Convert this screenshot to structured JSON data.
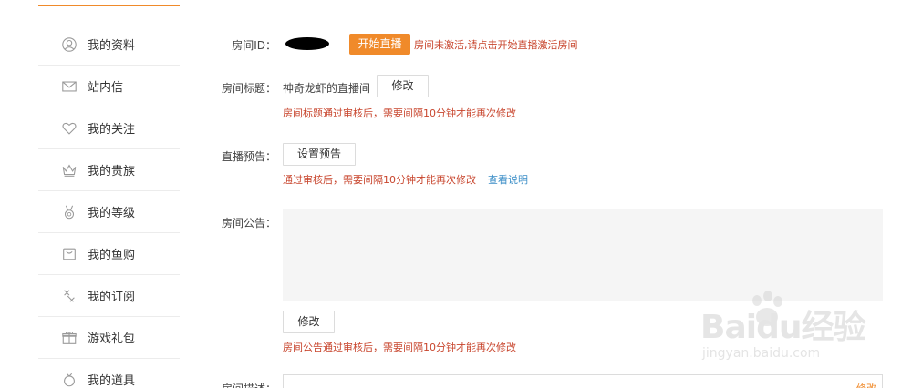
{
  "sidebar": {
    "items": [
      {
        "label": "我的资料",
        "icon": "user-icon"
      },
      {
        "label": "站内信",
        "icon": "mail-icon"
      },
      {
        "label": "我的关注",
        "icon": "heart-icon"
      },
      {
        "label": "我的贵族",
        "icon": "crown-icon"
      },
      {
        "label": "我的等级",
        "icon": "medal-icon"
      },
      {
        "label": "我的鱼购",
        "icon": "shopping-bag-icon"
      },
      {
        "label": "我的订阅",
        "icon": "subscribe-icon"
      },
      {
        "label": "游戏礼包",
        "icon": "gift-icon"
      },
      {
        "label": "我的道具",
        "icon": "item-icon"
      }
    ]
  },
  "room_id": {
    "label": "房间ID：",
    "start_button": "开始直播",
    "notice": "房间未激活,请点击开始直播激活房间"
  },
  "room_title": {
    "label": "房间标题：",
    "value": "神奇龙虾的直播间",
    "modify_button": "修改",
    "notice": "房间标题通过审核后，需要间隔10分钟才能再次修改"
  },
  "live_preview": {
    "label": "直播预告：",
    "set_button": "设置预告",
    "notice": "通过审核后，需要间隔10分钟才能再次修改",
    "link": "查看说明"
  },
  "room_announcement": {
    "label": "房间公告：",
    "value": "",
    "modify_button": "修改",
    "notice": "房间公告通过审核后，需要间隔10分钟才能再次修改"
  },
  "room_description": {
    "label": "房间描述：",
    "modify_link": "修改"
  },
  "watermark": {
    "brand": "Baidu经验",
    "url": "jingyan.baidu.com"
  },
  "colors": {
    "accent": "#f08a2a",
    "notice": "#c8452d",
    "link": "#3b8ec7"
  }
}
